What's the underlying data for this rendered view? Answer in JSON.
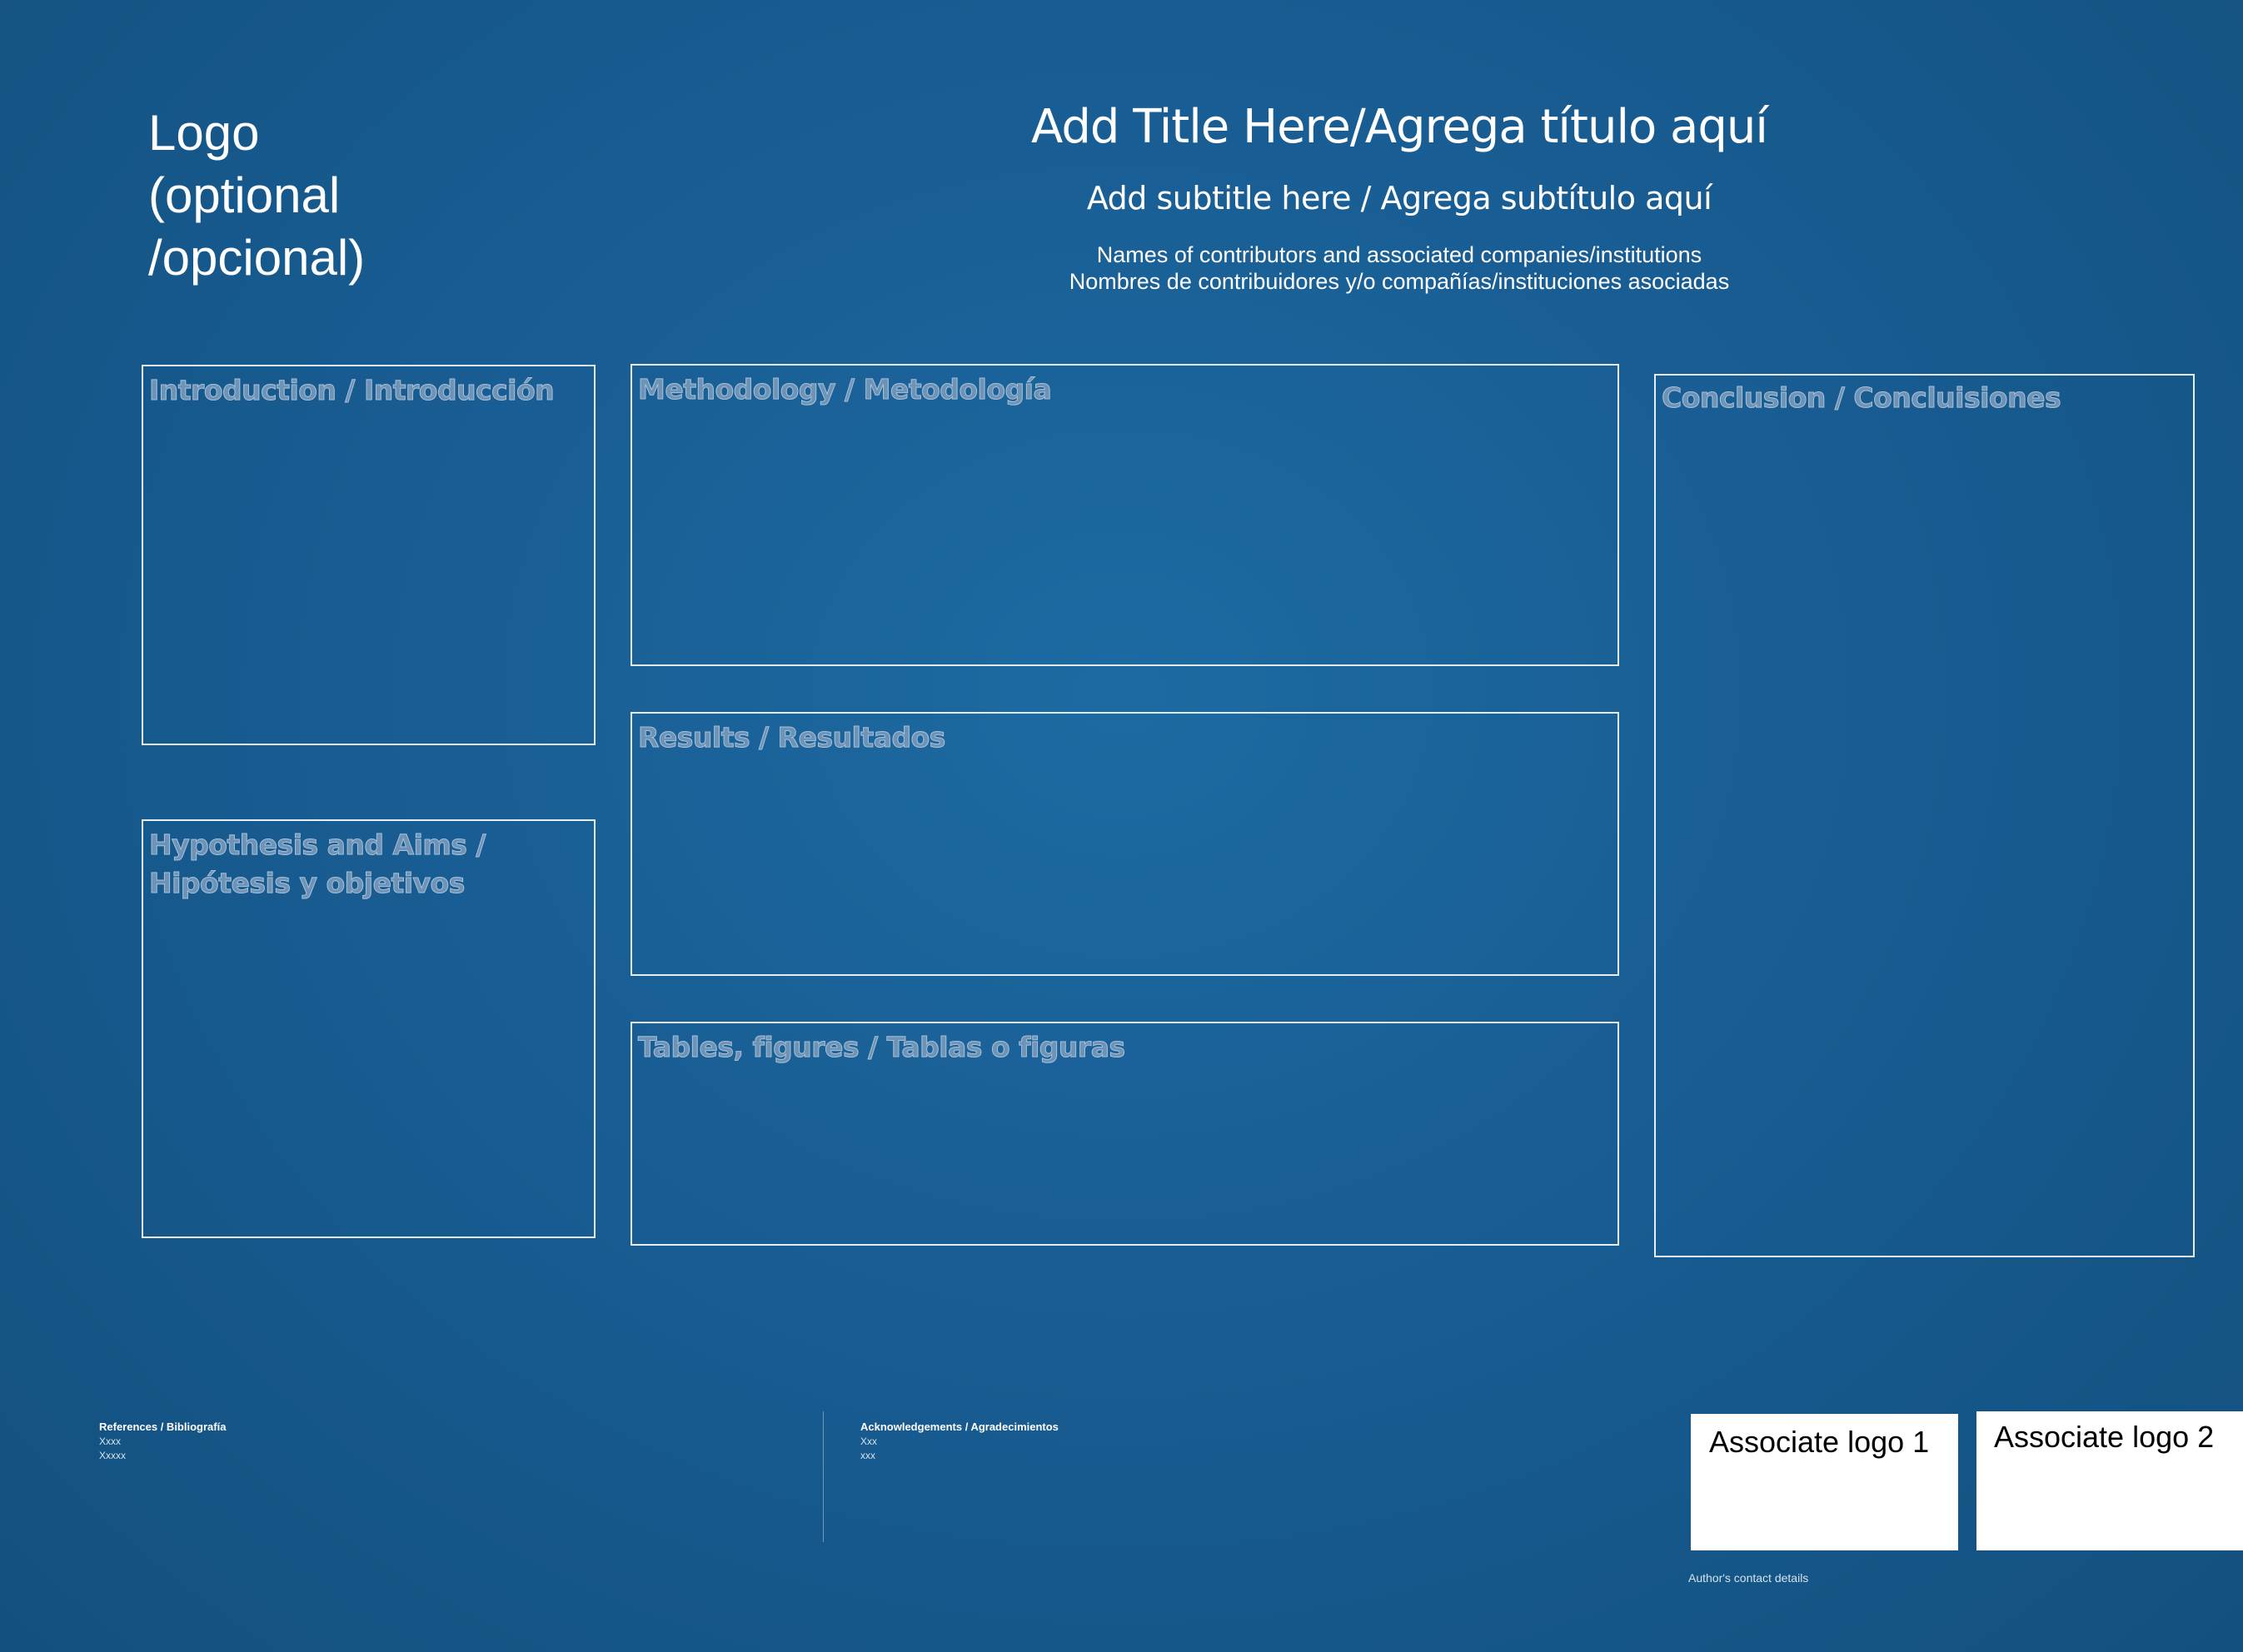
{
  "header": {
    "logo_lines": [
      "Logo",
      "(optional",
      "/opcional)"
    ],
    "title": "Add Title Here/Agrega título aquí",
    "subtitle": "Add subtitle here / Agrega subtítulo aquí",
    "contributors_line1": "Names of contributors and associated companies/institutions",
    "contributors_line2": "Nombres de contribuidores y/o compañías/instituciones asociadas"
  },
  "sections": {
    "introduction": "Introduction / Introducción",
    "hypothesis": "Hypothesis and Aims / Hipótesis y objetivos",
    "methodology": "Methodology / Metodología",
    "results": "Results / Resultados",
    "tables": "Tables, figures / Tablas o figuras",
    "conclusion": "Conclusion / Concluisiones"
  },
  "footer": {
    "references": {
      "heading": "References / Bibliografía",
      "items": [
        "Xxxx",
        "Xxxxx"
      ]
    },
    "acknowledgements": {
      "heading": "Acknowledgements / Agradecimientos",
      "items": [
        "Xxx",
        "xxx"
      ]
    },
    "associate_logo_1": "Associate logo 1",
    "associate_logo_2": "Associate logo 2",
    "contact": "Author's contact details"
  },
  "colors": {
    "background": "#185d93",
    "box_border": "#e6eef5",
    "heading_fill": "#6d93b7"
  }
}
